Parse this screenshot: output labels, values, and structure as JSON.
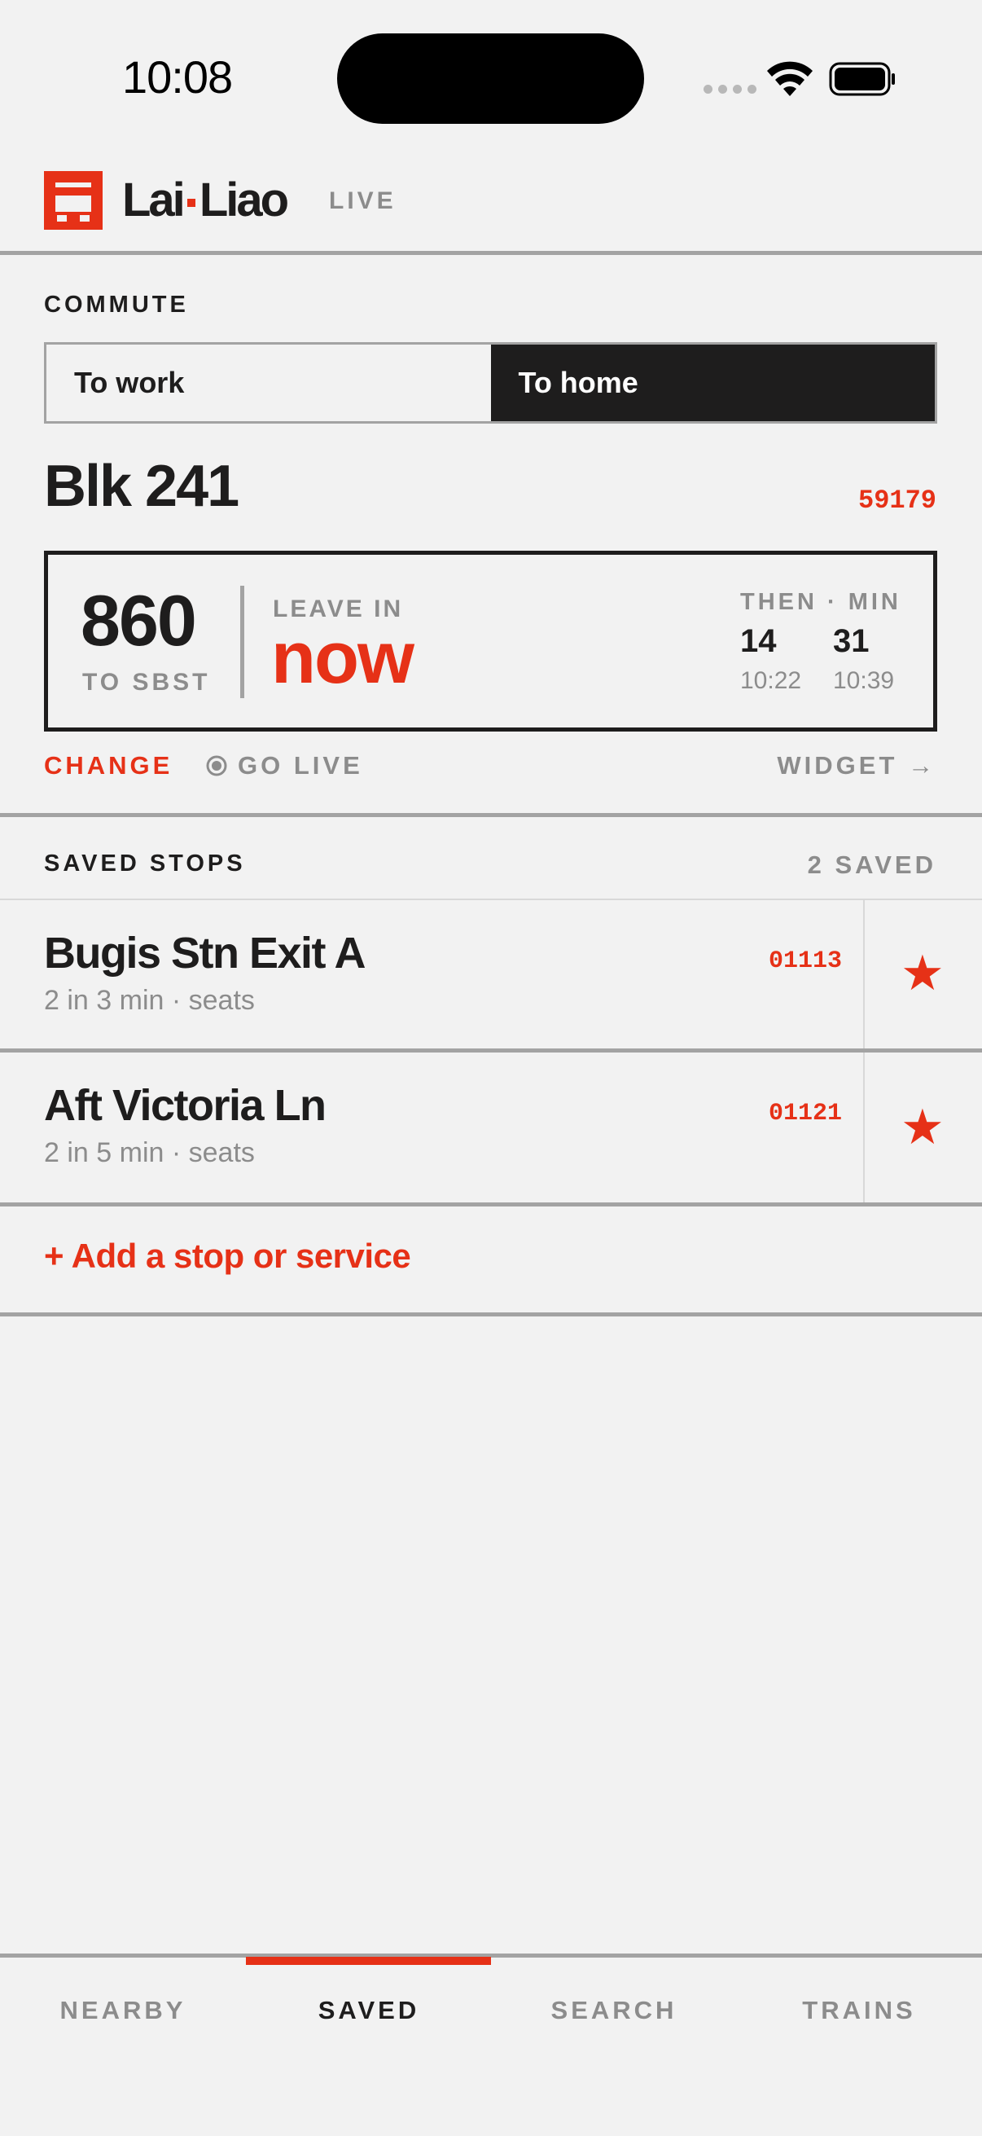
{
  "status_bar": {
    "time": "10:08"
  },
  "header": {
    "brand_left": "Lai",
    "brand_right": "Liao",
    "live_tag": "LIVE"
  },
  "commute": {
    "section_label": "COMMUTE",
    "tabs": [
      {
        "label": "To work",
        "selected": false
      },
      {
        "label": "To home",
        "selected": true
      }
    ],
    "stop_name": "Blk 241",
    "stop_code": "59179",
    "card": {
      "service": "860",
      "operator": "TO SBST",
      "leave_label": "LEAVE IN",
      "leave_value": "now",
      "then_label": "THEN · MIN",
      "then": [
        {
          "min": "14",
          "time": "10:22"
        },
        {
          "min": "31",
          "time": "10:39"
        }
      ]
    },
    "actions": {
      "change": "CHANGE",
      "go_live": "GO LIVE",
      "widget": "WIDGET →"
    }
  },
  "saved": {
    "section_label": "SAVED STOPS",
    "count": "2 SAVED",
    "items": [
      {
        "name": "Bugis Stn Exit A",
        "code": "01113",
        "detail": "2 in 3 min · seats"
      },
      {
        "name": "Aft Victoria Ln",
        "code": "01121",
        "detail": "2 in 5 min · seats"
      }
    ],
    "add_link": "+ Add a stop or service"
  },
  "tabbar": {
    "items": [
      {
        "label": "NEARBY",
        "active": false
      },
      {
        "label": "SAVED",
        "active": true
      },
      {
        "label": "SEARCH",
        "active": false
      },
      {
        "label": "TRAINS",
        "active": false
      }
    ]
  },
  "colors": {
    "accent": "#e63117",
    "ink": "#1e1d1d",
    "muted": "#8c8c8c",
    "background": "#f2f2f2"
  }
}
